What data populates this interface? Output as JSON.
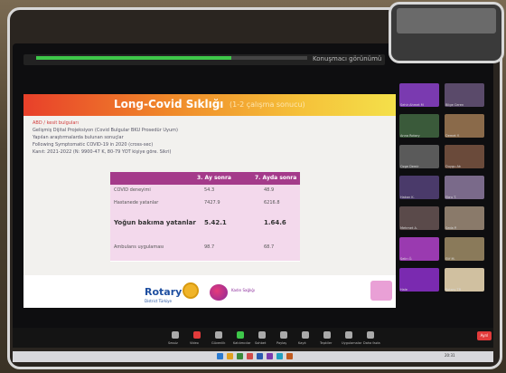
{
  "slide": {
    "title": "Long-Covid Sıklığı",
    "subtitle": "(1-2 çalışma sonucu)",
    "notes": [
      {
        "text": "ABD / kesit bulguları",
        "color": "red"
      },
      {
        "text": "Gelişmiş Dijital Projeksiyon (Covid Bulgular BKU Prosedür Uyum)",
        "color": "normal"
      },
      {
        "text": "Yapılan araştırmalarda bulunan sonuçlar",
        "color": "normal"
      },
      {
        "text": "Following Symptomatic COVID-19 in 2020 (cross-sec)",
        "color": "normal"
      },
      {
        "text": "Kanıt: 2021-2022 (N: 9900-47 K, 80-79 YOT kişiye göre. Sikri)",
        "color": "normal"
      }
    ],
    "table": {
      "headers": [
        "3. Ay sonra",
        "7. Ayda sonra"
      ],
      "rows": [
        {
          "label": "COVID deneyimi",
          "c1": "54.3",
          "c2": "48.9"
        },
        {
          "label": "Hastanede yatanlar",
          "c1": "7427.9",
          "c2": "6216.8"
        },
        {
          "label": "Yoğun bakıma yatanlar",
          "c1": "5.42.1",
          "c2": "1.64.6"
        },
        {
          "label": "Ambulans uygulaması",
          "c1": "98.7",
          "c2": "68.7"
        }
      ]
    },
    "footer": {
      "rotary": "Rotary",
      "rotary_sub": "District Türkiye",
      "org": "Kadın Sağlığı"
    }
  },
  "meeting": {
    "topbar_text": "Konuşmacı görünümü",
    "progress": 0.72,
    "participants": [
      {
        "name": "Sehir Ahmet M",
        "color": "#7a3ab0"
      },
      {
        "name": "Bilge Ceren",
        "color": "#5a4a6a"
      },
      {
        "name": "Anna Rotary",
        "color": "#3a5a3a"
      },
      {
        "name": "Demet Y.",
        "color": "#8a6a4a"
      },
      {
        "name": "Ozge Demir",
        "color": "#5a5a5a"
      },
      {
        "name": "Duygu Ak",
        "color": "#6a4a3a"
      },
      {
        "name": "Hakan K.",
        "color": "#4a3a6a"
      },
      {
        "name": "Ebru T.",
        "color": "#7a6a8a"
      },
      {
        "name": "Mehmet A.",
        "color": "#5a4a4a"
      },
      {
        "name": "Seda P.",
        "color": "#8a7a6a"
      },
      {
        "name": "Selin Ö.",
        "color": "#9a3ab0"
      },
      {
        "name": "Elif M.",
        "color": "#8a7a5a"
      },
      {
        "name": "Hale",
        "color": "#7a2ab0"
      },
      {
        "name": "Rotary TR",
        "color": "#d0c0a0"
      }
    ],
    "toolbar": [
      {
        "label": "Sessiz",
        "icon": "mic-icon",
        "kind": "normal"
      },
      {
        "label": "Video",
        "icon": "video-icon",
        "kind": "red"
      },
      {
        "label": "Güvenlik",
        "icon": "shield-icon",
        "kind": "normal"
      },
      {
        "label": "Katılımcılar",
        "icon": "people-icon",
        "kind": "green"
      },
      {
        "label": "Sohbet",
        "icon": "chat-icon",
        "kind": "normal"
      },
      {
        "label": "Paylaş",
        "icon": "share-icon",
        "kind": "normal"
      },
      {
        "label": "Kayıt",
        "icon": "record-icon",
        "kind": "normal"
      },
      {
        "label": "Tepkiler",
        "icon": "reaction-icon",
        "kind": "normal"
      },
      {
        "label": "Uygulamalar",
        "icon": "apps-icon",
        "kind": "normal"
      },
      {
        "label": "Daha fazla",
        "icon": "more-icon",
        "kind": "normal"
      }
    ],
    "leave_label": "Ayrıl"
  },
  "taskbar": {
    "clock": "20:31"
  }
}
